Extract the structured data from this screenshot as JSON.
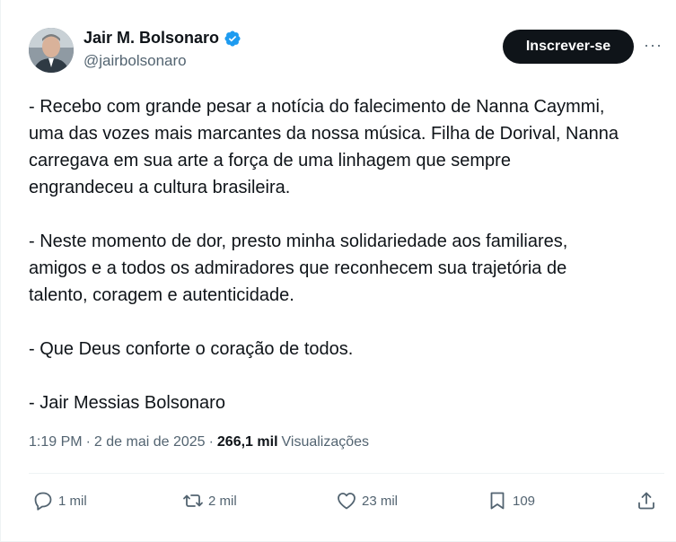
{
  "author": {
    "display_name": "Jair M. Bolsonaro",
    "handle": "@jairbolsonaro",
    "verified_icon": "verified-badge-icon"
  },
  "header": {
    "follow_label": "Inscrever-se",
    "more_label": "···"
  },
  "tweet": {
    "paragraphs": [
      [
        "- Recebo com grande pesar a notícia do falecimento de Nanna Caymmi,",
        "uma das vozes mais marcantes da nossa música. Filha de Dorival, Nanna",
        "carregava em sua arte a força de uma linhagem que sempre",
        "engrandeceu a cultura brasileira."
      ],
      [
        "- Neste momento de dor, presto minha solidariedade aos familiares,",
        "amigos e a todos os admiradores que reconhecem sua trajetória de",
        "talento, coragem e autenticidade."
      ],
      [
        "- Que Deus conforte o coração de todos."
      ],
      [
        "- Jair Messias Bolsonaro"
      ]
    ]
  },
  "meta": {
    "time": "1:19 PM",
    "separator": "·",
    "date": "2 de mai de 2025",
    "views_count": "266,1 mil",
    "views_label": "Visualizações"
  },
  "actions": {
    "replies": "1 mil",
    "reposts": "2 mil",
    "likes": "23 mil",
    "bookmarks": "109"
  },
  "colors": {
    "text": "#0f1419",
    "secondary": "#536471",
    "verified": "#1d9bf0",
    "button": "#0f1419"
  }
}
